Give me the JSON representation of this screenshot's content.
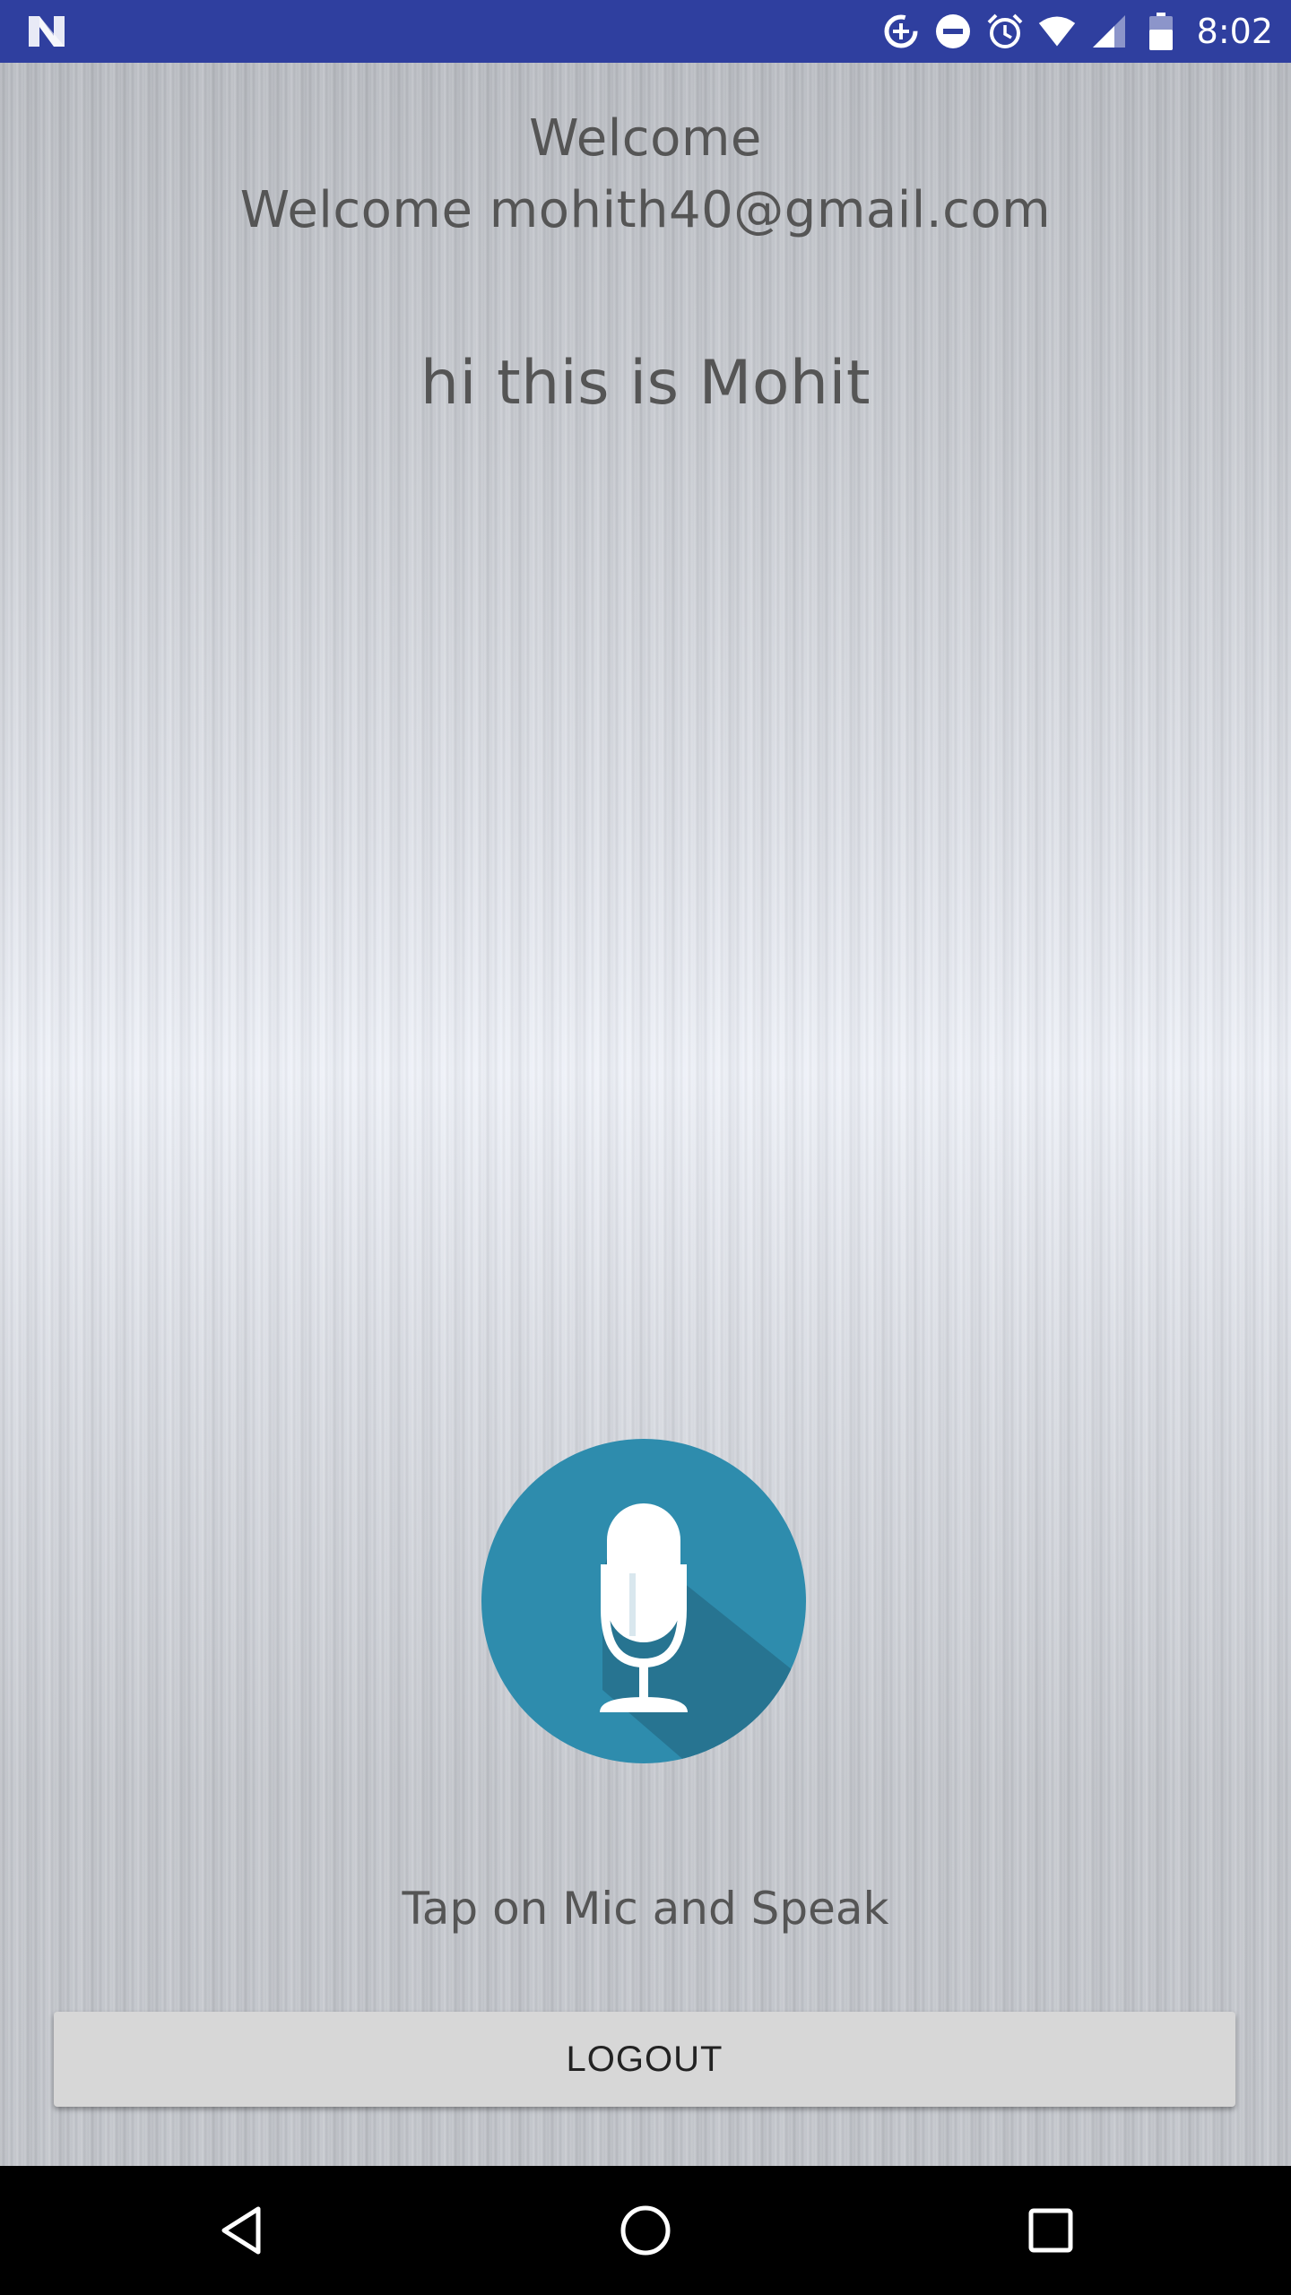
{
  "status_bar": {
    "time": "8:02",
    "left_icon": "android-n-logo-icon",
    "icons": [
      "data-saver-icon",
      "do-not-disturb-icon",
      "alarm-icon",
      "wifi-icon",
      "cell-signal-icon",
      "battery-icon"
    ],
    "color": "#2f3f9f"
  },
  "main": {
    "welcome_title": "Welcome",
    "welcome_email": "Welcome mohith40@gmail.com",
    "spoken_text": "hi this is Mohit",
    "mic_icon": "microphone-icon",
    "mic_color": "#2e8cad",
    "hint": "Tap on Mic and Speak",
    "logout_label": "LOGOUT"
  },
  "nav_bar": {
    "buttons": [
      "back-icon",
      "home-icon",
      "recents-icon"
    ]
  }
}
